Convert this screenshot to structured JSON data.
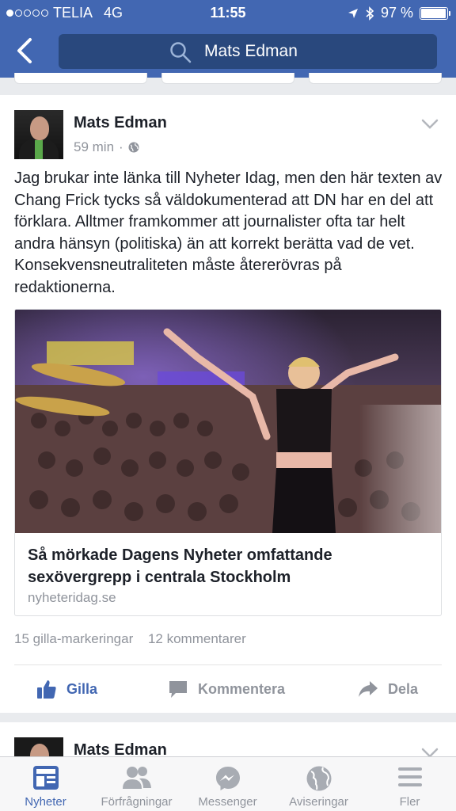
{
  "status_bar": {
    "carrier": "TELIA",
    "network": "4G",
    "time": "11:55",
    "battery": "97 %",
    "battery_level": 0.97
  },
  "search": {
    "query": "Mats Edman"
  },
  "post": {
    "author": "Mats Edman",
    "time": "59 min",
    "separator": "·",
    "text": "Jag brukar inte länka till Nyheter Idag, men den här texten av Chang Frick tycks så väldokumenterad att DN har en del att förklara. Alltmer framkommer att journalister ofta tar helt andra hänsyn (politiska) än att korrekt berätta vad de vet. Konsekvensneutraliteten måste återerövras på redaktionerna.",
    "link": {
      "title": "Så mörkade Dagens Nyheter omfattande sexövergrepp i centrala Stockholm",
      "domain": "nyheteridag.se"
    },
    "likes": "15 gilla-markeringar",
    "comments": "12 kommentarer",
    "actions": {
      "like": "Gilla",
      "comment": "Kommentera",
      "share": "Dela"
    }
  },
  "next_post": {
    "author": "Mats Edman"
  },
  "tabs": [
    {
      "label": "Nyheter",
      "icon": "news-feed-icon",
      "active": true
    },
    {
      "label": "Förfrågningar",
      "icon": "friend-requests-icon",
      "active": false
    },
    {
      "label": "Messenger",
      "icon": "messenger-icon",
      "active": false
    },
    {
      "label": "Aviseringar",
      "icon": "globe-icon",
      "active": false
    },
    {
      "label": "Fler",
      "icon": "menu-icon",
      "active": false
    }
  ],
  "colors": {
    "brand": "#4267b2",
    "search_bg": "#29487d",
    "muted": "#90949c"
  }
}
